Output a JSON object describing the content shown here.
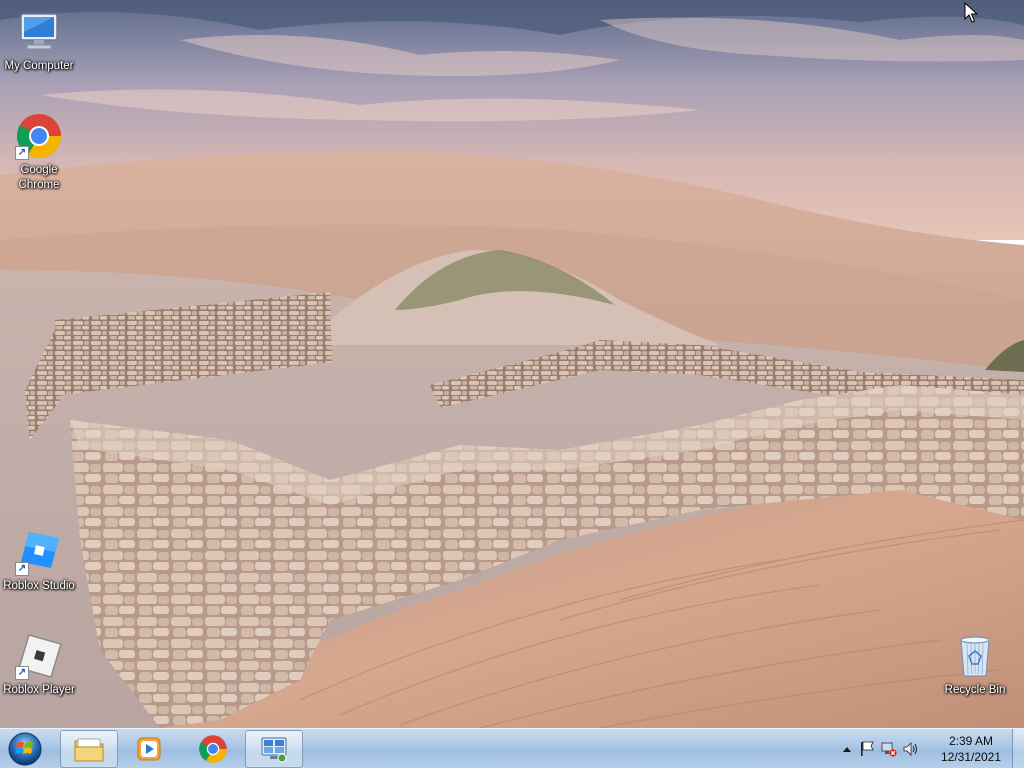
{
  "desktop": {
    "icons": [
      {
        "label": "My Computer",
        "icon": "computer-icon"
      },
      {
        "label": "Google\nChrome",
        "icon": "chrome-icon"
      },
      {
        "label": "Roblox Studio",
        "icon": "roblox-studio-icon"
      },
      {
        "label": "Roblox Player",
        "icon": "roblox-player-icon"
      },
      {
        "label": "Recycle Bin",
        "icon": "recycle-bin-icon"
      }
    ]
  },
  "taskbar": {
    "pinned": [
      {
        "name": "Windows Explorer",
        "icon": "folder-icon"
      },
      {
        "name": "Windows Media Player",
        "icon": "media-player-icon"
      },
      {
        "name": "Google Chrome",
        "icon": "chrome-icon"
      },
      {
        "name": "Remote Desktop",
        "icon": "remote-desktop-icon"
      }
    ],
    "clock": {
      "time": "2:39 AM",
      "date": "12/31/2021"
    }
  },
  "colors": {
    "taskbar": "#aac7e6",
    "chrome_red": "#db4437",
    "chrome_green": "#0f9d58",
    "chrome_yellow": "#f4b400",
    "chrome_blue": "#4285f4",
    "roblox_blue": "#1e90ff"
  }
}
